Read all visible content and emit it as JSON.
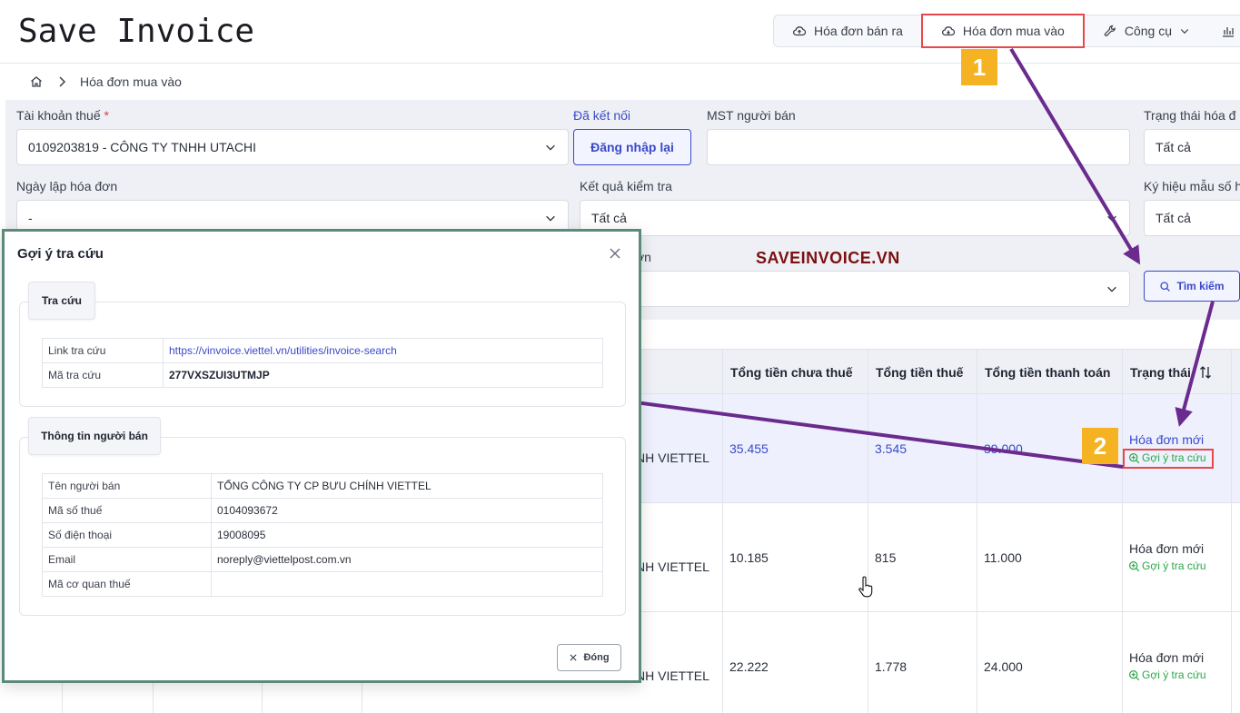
{
  "app": {
    "logo": "Save Invoice"
  },
  "topnav": {
    "items": [
      {
        "label": "Hóa đơn bán ra",
        "icon": "cloud-upload-icon"
      },
      {
        "label": "Hóa đơn mua vào",
        "icon": "cloud-download-icon",
        "active": true
      },
      {
        "label": "Công cụ",
        "icon": "wrench-icon"
      }
    ]
  },
  "breadcrumb": {
    "home_icon": "home-icon",
    "current": "Hóa đơn mua vào"
  },
  "filters": {
    "tax_account": {
      "label": "Tài khoản thuế",
      "required_mark": "*",
      "value": "0109203819 - CÔNG TY TNHH UTACHI"
    },
    "connection_status": "Đã kết nối",
    "relogin_button": "Đăng nhập lại",
    "seller_tax_id": {
      "label": "MST người bán",
      "value": ""
    },
    "invoice_status": {
      "label": "Trạng thái hóa đ",
      "value": "Tất cả"
    },
    "invoice_date": {
      "label": "Ngày lập hóa đơn",
      "value": "-"
    },
    "check_result": {
      "label": "Kết quả kiểm tra",
      "value": "Tất cả"
    },
    "symbol": {
      "label": "Ký hiệu mẫu số h",
      "value": "Tất cả"
    },
    "hidden_label_tail": "ơn",
    "search_button": "Tìm kiếm"
  },
  "watermark": "SAVEINVOICE.VN",
  "table": {
    "headers": [
      "Tổng tiền chưa thuế",
      "Tổng tiền thuế",
      "Tổng tiền thanh toán",
      "Trạng thái"
    ],
    "sort_icon": "sort-icon",
    "rows": [
      {
        "seller_tail": "NH VIETTEL",
        "subtotal": "35.455",
        "tax": "3.545",
        "total": "39.000",
        "status": "Hóa đơn mới",
        "suggest": "Gợi ý tra cứu"
      },
      {
        "seller_tail": "NH VIETTEL",
        "subtotal": "10.185",
        "tax": "815",
        "total": "11.000",
        "status": "Hóa đơn mới",
        "suggest": "Gợi ý tra cứu"
      },
      {
        "seller_tail": "NH VIETTEL",
        "subtotal": "22.222",
        "tax": "1.778",
        "total": "24.000",
        "status": "Hóa đơn mới",
        "suggest": "Gợi ý tra cứu"
      }
    ]
  },
  "badges": [
    "1",
    "2"
  ],
  "modal": {
    "title": "Gợi ý tra cứu",
    "lookup": {
      "tab": "Tra cứu",
      "link_label": "Link tra cứu",
      "link_value": "https://vinvoice.viettel.vn/utilities/invoice-search",
      "code_label": "Mã tra cứu",
      "code_value": "277VXSZUI3UTMJP"
    },
    "seller": {
      "tab": "Thông tin người bán",
      "rows": [
        {
          "label": "Tên người bán",
          "value": "TỔNG CÔNG TY CP BƯU CHÍNH VIETTEL"
        },
        {
          "label": "Mã số thuế",
          "value": "0104093672"
        },
        {
          "label": "Số điện thoại",
          "value": "19008095"
        },
        {
          "label": "Email",
          "value": "noreply@viettelpost.com.vn"
        },
        {
          "label": "Mã cơ quan thuế",
          "value": ""
        }
      ]
    },
    "close_button": "Đóng"
  },
  "colors": {
    "accent": "#3b49c9",
    "highlight": "#e8484b",
    "badge": "#f5b324",
    "arrow": "#6a2a8e",
    "success": "#2aa84a",
    "modal_border": "#5b8a78"
  }
}
